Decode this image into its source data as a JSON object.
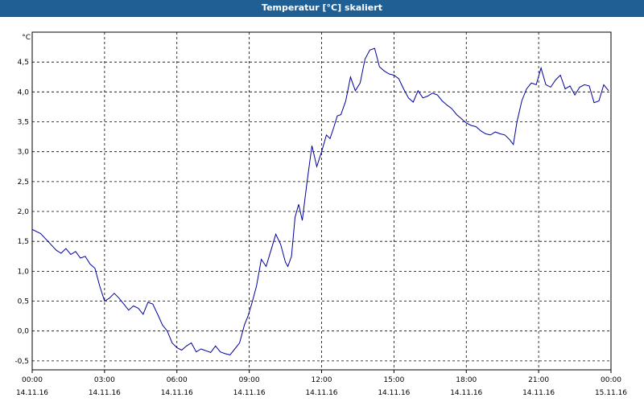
{
  "window": {
    "title": "Temperatur [°C] skaliert"
  },
  "chart_data": {
    "type": "line",
    "title": "Temperatur [°C] skaliert",
    "ylabel": "°C",
    "xlabel": "",
    "ylim": [
      -0.65,
      5.0
    ],
    "xlim": [
      "14.11.16 00:00",
      "15.11.16 00:00"
    ],
    "grid": true,
    "y_ticks": [
      "-0.5",
      "0.0",
      "0.5",
      "1.0",
      "1.5",
      "2.0",
      "2.5",
      "3.0",
      "3.5",
      "4.0",
      "4.5"
    ],
    "y_tick_labels": [
      "-0,5",
      "0,0",
      "0,5",
      "1,0",
      "1,5",
      "2,0",
      "2,5",
      "3,0",
      "3,5",
      "4,0",
      "4,5"
    ],
    "x_ticks": [
      {
        "time": "00:00",
        "date": "14.11.16",
        "hour": 0
      },
      {
        "time": "03:00",
        "date": "14.11.16",
        "hour": 3
      },
      {
        "time": "06:00",
        "date": "14.11.16",
        "hour": 6
      },
      {
        "time": "09:00",
        "date": "14.11.16",
        "hour": 9
      },
      {
        "time": "12:00",
        "date": "14.11.16",
        "hour": 12
      },
      {
        "time": "15:00",
        "date": "14.11.16",
        "hour": 15
      },
      {
        "time": "18:00",
        "date": "14.11.16",
        "hour": 18
      },
      {
        "time": "21:00",
        "date": "14.11.16",
        "hour": 21
      },
      {
        "time": "00:00",
        "date": "15.11.16",
        "hour": 24
      }
    ],
    "series": [
      {
        "color": "#00009c",
        "x_hours": [
          0,
          0.35,
          0.7,
          1.0,
          1.2,
          1.4,
          1.6,
          1.8,
          2.0,
          2.2,
          2.4,
          2.6,
          2.8,
          3.0,
          3.2,
          3.4,
          3.6,
          3.8,
          4.0,
          4.2,
          4.4,
          4.6,
          4.8,
          5.0,
          5.2,
          5.4,
          5.6,
          5.8,
          6.0,
          6.2,
          6.4,
          6.6,
          6.8,
          7.0,
          7.2,
          7.4,
          7.6,
          7.8,
          8.0,
          8.2,
          8.4,
          8.6,
          8.8,
          8.95,
          9.1,
          9.3,
          9.5,
          9.7,
          9.9,
          10.1,
          10.3,
          10.5,
          10.6,
          10.75,
          10.9,
          11.05,
          11.2,
          11.4,
          11.6,
          11.8,
          12.0,
          12.2,
          12.35,
          12.5,
          12.65,
          12.8,
          13.0,
          13.2,
          13.4,
          13.6,
          13.8,
          14.0,
          14.2,
          14.4,
          14.6,
          14.8,
          15.0,
          15.2,
          15.4,
          15.6,
          15.8,
          16.0,
          16.2,
          16.4,
          16.6,
          16.8,
          17.0,
          17.2,
          17.4,
          17.6,
          17.8,
          18.0,
          18.2,
          18.4,
          18.6,
          18.8,
          19.0,
          19.2,
          19.4,
          19.6,
          19.8,
          19.95,
          20.1,
          20.3,
          20.5,
          20.7,
          20.9,
          21.1,
          21.3,
          21.5,
          21.7,
          21.9,
          22.1,
          22.3,
          22.5,
          22.7,
          22.9,
          23.1,
          23.3,
          23.5,
          23.7,
          23.9
        ],
        "values": [
          1.7,
          1.63,
          1.48,
          1.35,
          1.3,
          1.38,
          1.28,
          1.33,
          1.22,
          1.25,
          1.12,
          1.05,
          0.75,
          0.5,
          0.55,
          0.63,
          0.55,
          0.45,
          0.35,
          0.42,
          0.38,
          0.28,
          0.48,
          0.45,
          0.28,
          0.1,
          0.0,
          -0.2,
          -0.28,
          -0.32,
          -0.25,
          -0.2,
          -0.35,
          -0.3,
          -0.33,
          -0.36,
          -0.25,
          -0.35,
          -0.38,
          -0.4,
          -0.3,
          -0.2,
          0.1,
          0.25,
          0.45,
          0.75,
          1.2,
          1.08,
          1.35,
          1.62,
          1.45,
          1.15,
          1.08,
          1.25,
          1.9,
          2.12,
          1.85,
          2.5,
          3.1,
          2.75,
          3.0,
          3.28,
          3.22,
          3.4,
          3.6,
          3.62,
          3.85,
          4.25,
          4.02,
          4.15,
          4.55,
          4.7,
          4.73,
          4.42,
          4.35,
          4.3,
          4.28,
          4.22,
          4.05,
          3.9,
          3.83,
          4.02,
          3.9,
          3.93,
          3.98,
          3.95,
          3.85,
          3.78,
          3.72,
          3.62,
          3.55,
          3.48,
          3.44,
          3.42,
          3.35,
          3.3,
          3.28,
          3.33,
          3.3,
          3.28,
          3.2,
          3.12,
          3.5,
          3.85,
          4.05,
          4.15,
          4.12,
          4.4,
          4.12,
          4.08,
          4.2,
          4.28,
          4.05,
          4.1,
          3.95,
          4.08,
          4.12,
          4.1,
          3.82,
          3.85,
          4.12,
          4.02,
          3.85,
          4.05
        ]
      }
    ]
  }
}
